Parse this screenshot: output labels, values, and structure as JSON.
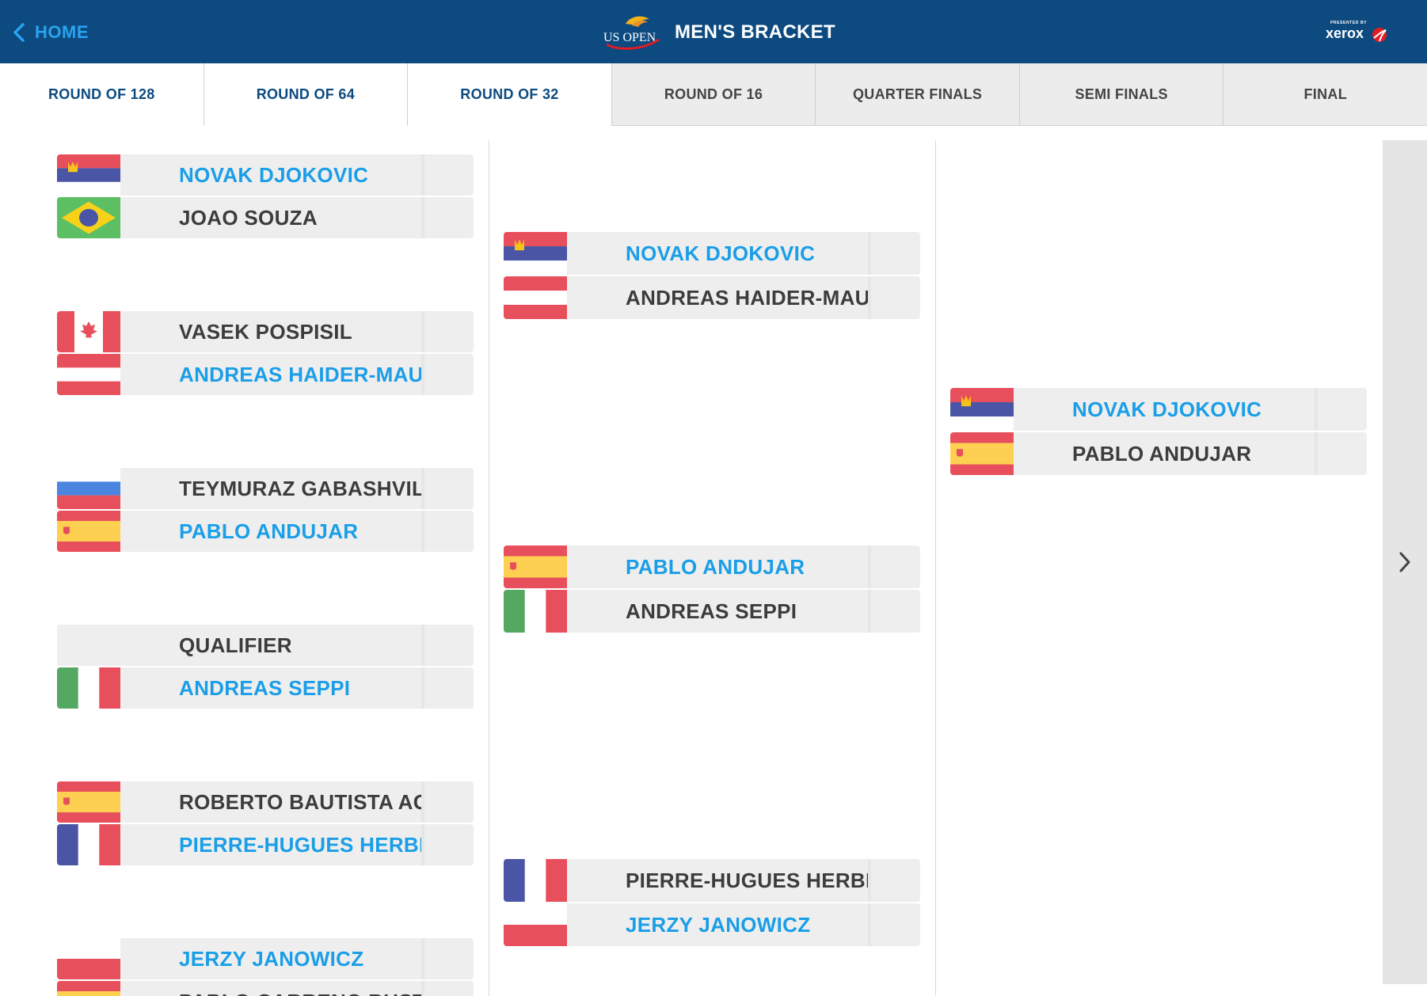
{
  "header": {
    "home_label": "HOME",
    "logo_text": "US OPEN",
    "title": "MEN'S BRACKET",
    "sponsor_presented": "PRESENTED BY",
    "sponsor_name": "xerox",
    "background": "#0c4a80",
    "accent": "#2aa3f0"
  },
  "tabs": [
    {
      "label": "ROUND OF 128",
      "active": true
    },
    {
      "label": "ROUND OF 64",
      "active": true
    },
    {
      "label": "ROUND OF 32",
      "active": true
    },
    {
      "label": "ROUND OF 16",
      "active": false
    },
    {
      "label": "QUARTER FINALS",
      "active": false
    },
    {
      "label": "SEMI FINALS",
      "active": false
    },
    {
      "label": "FINAL",
      "active": false
    }
  ],
  "columns": [
    {
      "round": "ROUND OF 32",
      "matches": [
        {
          "players": [
            {
              "name": "NOVAK DJOKOVIC",
              "flag": "serbia",
              "winner": true
            },
            {
              "name": "JOAO SOUZA",
              "flag": "brazil",
              "winner": false
            }
          ]
        },
        {
          "players": [
            {
              "name": "VASEK POSPISIL",
              "flag": "canada",
              "winner": false
            },
            {
              "name": "ANDREAS HAIDER-MAURER",
              "flag": "austria",
              "winner": true
            }
          ]
        },
        {
          "players": [
            {
              "name": "TEYMURAZ GABASHVILI",
              "flag": "russia",
              "winner": false
            },
            {
              "name": "PABLO ANDUJAR",
              "flag": "spain",
              "winner": true
            }
          ]
        },
        {
          "players": [
            {
              "name": "QUALIFIER",
              "flag": "none",
              "winner": false
            },
            {
              "name": "ANDREAS SEPPI",
              "flag": "italy",
              "winner": true
            }
          ]
        },
        {
          "players": [
            {
              "name": "ROBERTO BAUTISTA AGUT",
              "flag": "spain",
              "winner": false
            },
            {
              "name": "PIERRE-HUGUES HERBERT",
              "flag": "france",
              "winner": true
            }
          ]
        },
        {
          "players": [
            {
              "name": "JERZY JANOWICZ",
              "flag": "poland",
              "winner": true
            },
            {
              "name": "PABLO CARRENO BUSTA",
              "flag": "spain",
              "winner": false
            }
          ]
        }
      ]
    },
    {
      "round": "ROUND OF 16",
      "matches": [
        {
          "players": [
            {
              "name": "NOVAK DJOKOVIC",
              "flag": "serbia",
              "winner": true
            },
            {
              "name": "ANDREAS HAIDER-MAURER",
              "flag": "austria",
              "winner": false
            }
          ]
        },
        {
          "players": [
            {
              "name": "PABLO ANDUJAR",
              "flag": "spain",
              "winner": true
            },
            {
              "name": "ANDREAS SEPPI",
              "flag": "italy",
              "winner": false
            }
          ]
        },
        {
          "players": [
            {
              "name": "PIERRE-HUGUES HERBERT",
              "flag": "france",
              "winner": false
            },
            {
              "name": "JERZY JANOWICZ",
              "flag": "poland",
              "winner": true
            }
          ]
        }
      ]
    },
    {
      "round": "QUARTER FINALS",
      "matches": [
        {
          "players": [
            {
              "name": "NOVAK DJOKOVIC",
              "flag": "serbia",
              "winner": true
            },
            {
              "name": "PABLO ANDUJAR",
              "flag": "spain",
              "winner": false
            }
          ]
        }
      ]
    }
  ],
  "colors": {
    "winner": "#1a9ee8",
    "loser": "#3c3c3c",
    "row_bg": "#eeeeee"
  },
  "icons": {
    "back": "chevron-left-icon",
    "next": "chevron-right-icon"
  }
}
